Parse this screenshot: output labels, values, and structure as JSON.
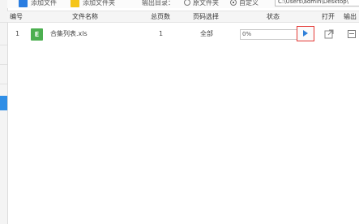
{
  "toolbar": {
    "add_file_label": "添加文件",
    "add_folder_label": "添加文件夹",
    "output_dir_label": "输出目录：",
    "option_source_folder": "原文件夹",
    "option_custom": "自定义",
    "selected_option": "自定义",
    "output_path": "C:\\Users\\admin\\Desktop\\"
  },
  "table": {
    "columns": [
      "编号",
      "文件名称",
      "总页数",
      "页码选择",
      "状态",
      "打开",
      "输出"
    ],
    "rows": [
      {
        "index": "1",
        "file_type_badge": "E",
        "file_name": "合集列表.xls",
        "total_pages": "1",
        "page_selection": "全部",
        "status": "0%",
        "progress": 0
      }
    ]
  },
  "colors": {
    "accent_blue": "#2f8ee6",
    "excel_green": "#4caf50",
    "highlight_red": "#e53935"
  },
  "icons": [
    "add-file-icon",
    "add-folder-icon",
    "play-icon",
    "open-external-icon",
    "output-folder-icon"
  ]
}
